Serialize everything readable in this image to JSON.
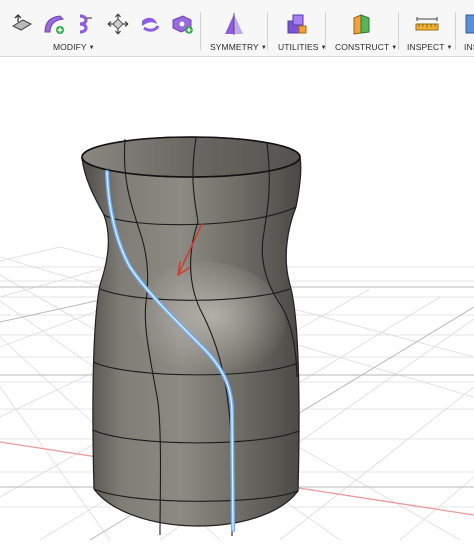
{
  "toolbar": {
    "groups": [
      {
        "label": "MODIFY",
        "icons": [
          "press-pull-icon",
          "fillet-icon",
          "offset-face-icon",
          "move-copy-icon",
          "edit-form-icon",
          "modify-add-icon"
        ]
      },
      {
        "label": "SYMMETRY",
        "icons": [
          "mirror-symmetry-icon"
        ]
      },
      {
        "label": "UTILITIES",
        "icons": [
          "utilities-icon"
        ]
      },
      {
        "label": "CONSTRUCT",
        "icons": [
          "construct-plane-icon"
        ]
      },
      {
        "label": "INSPECT",
        "icons": [
          "measure-icon"
        ]
      },
      {
        "label": "INS",
        "icons": [
          "insert-icon"
        ]
      }
    ]
  },
  "colors": {
    "toolbar_bg": "#f7f7f7",
    "accent_purple": "#8e5ee0",
    "highlight_blue": "#6fb1ff",
    "annotation_arrow": "#d23b2f",
    "grid_red_axis": "#e99a9a"
  }
}
